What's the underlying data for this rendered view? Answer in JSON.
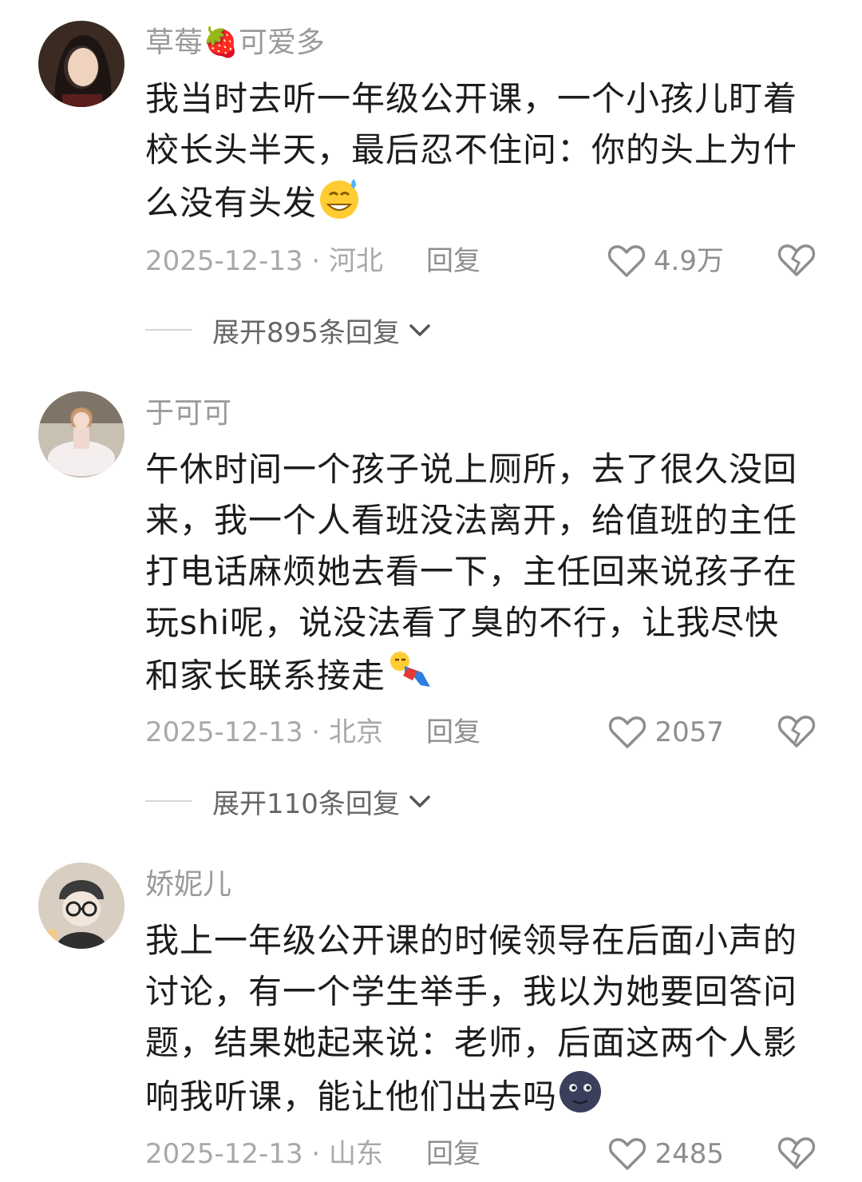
{
  "comments": [
    {
      "username": "草莓🍓可爱多",
      "text": "我当时去听一年级公开课，一个小孩儿盯着校长头半天，最后忍不住问：你的头上为什么没有头发",
      "emoji": "😅",
      "date_location": "2025-12-13 · 河北",
      "reply_label": "回复",
      "likes": "4.9万",
      "expand_label": "展开895条回复"
    },
    {
      "username": "于可可",
      "text": "午休时间一个孩子说上厕所，去了很久没回来，我一个人看班没法离开，给值班的主任打电话麻烦她去看一下，主任回来说孩子在玩shi呢，说没法看了臭的不行，让我尽快和家长联系接走",
      "emoji": "🤸",
      "date_location": "2025-12-13 · 北京",
      "reply_label": "回复",
      "likes": "2057",
      "expand_label": "展开110条回复"
    },
    {
      "username": "娇妮儿",
      "text": "我上一年级公开课的时候领导在后面小声的讨论，有一个学生举手，我以为她要回答问题，结果她起来说：老师，后面这两个人影响我听课，能让他们出去吗",
      "emoji": "🌚",
      "date_location": "2025-12-13 · 山东",
      "reply_label": "回复",
      "likes": "2485"
    }
  ],
  "colors": {
    "username": "#9a9a9a",
    "meta": "#a8a8a8",
    "text": "#1c1c1c"
  }
}
